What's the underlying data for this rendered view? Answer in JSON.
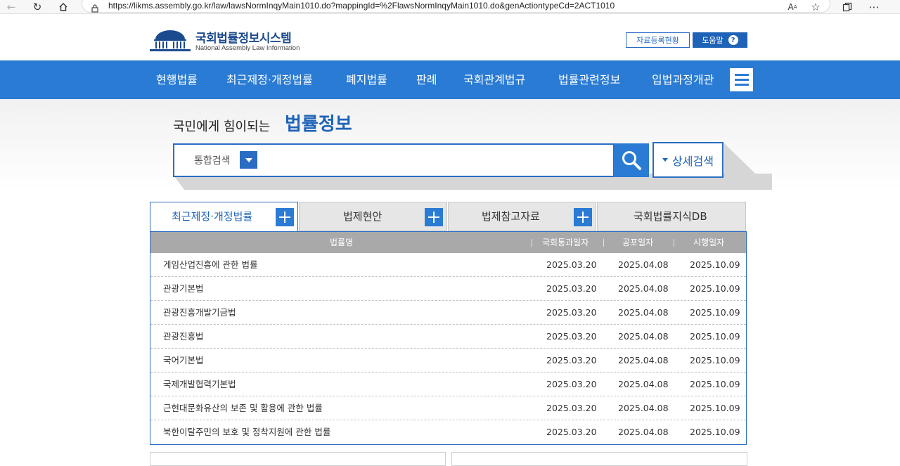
{
  "browser": {
    "url": "https://likms.assembly.go.kr/law/lawsNormInqyMain1010.do?mappingId=%2FlawsNormInqyMain1010.do&genActiontypeCd=2ACT1010",
    "icons": [
      "back-icon",
      "refresh-icon",
      "home-icon",
      "lock-icon",
      "read-aloud-icon",
      "favorite-star-icon",
      "collections-icon",
      "more-icon"
    ]
  },
  "header": {
    "title": "국회법률정보시스템",
    "subtitle": "National Assembly Law Information",
    "reg_status": "자료등록현황",
    "help": "도움말",
    "help_icon": "?"
  },
  "nav": {
    "items": [
      "현행법률",
      "최근제정·개정법률",
      "폐지법률",
      "판례",
      "국회관계법규",
      "법률관련정보",
      "입법과정개관"
    ]
  },
  "search": {
    "tagline_prefix": "국민에게 힘이되는",
    "tagline_emphasis": "법률정보",
    "type": "통합검색",
    "query": "",
    "advanced": "상세검색"
  },
  "tabs": [
    "최근제정·개정법률",
    "법제현안",
    "법제참고자료",
    "국회법률지식DB"
  ],
  "table": {
    "headers": [
      "법률명",
      "국회통과일자",
      "공포일자",
      "시행일자"
    ],
    "rows": [
      {
        "name": "게임산업진흥에 관한 법률",
        "passed": "2025.03.20",
        "promulgated": "2025.04.08",
        "effective": "2025.10.09"
      },
      {
        "name": "관광기본법",
        "passed": "2025.03.20",
        "promulgated": "2025.04.08",
        "effective": "2025.10.09"
      },
      {
        "name": "관광진흥개발기금법",
        "passed": "2025.03.20",
        "promulgated": "2025.04.08",
        "effective": "2025.10.09"
      },
      {
        "name": "관광진흥법",
        "passed": "2025.03.20",
        "promulgated": "2025.04.08",
        "effective": "2025.10.09"
      },
      {
        "name": "국어기본법",
        "passed": "2025.03.20",
        "promulgated": "2025.04.08",
        "effective": "2025.10.09"
      },
      {
        "name": "국제개발협력기본법",
        "passed": "2025.03.20",
        "promulgated": "2025.04.08",
        "effective": "2025.10.09"
      },
      {
        "name": "근현대문화유산의 보존 및 활용에 관한 법률",
        "passed": "2025.03.20",
        "promulgated": "2025.04.08",
        "effective": "2025.10.09"
      },
      {
        "name": "북한이탈주민의 보호 및 정착지원에 관한 법률",
        "passed": "2025.03.20",
        "promulgated": "2025.04.08",
        "effective": "2025.10.09"
      }
    ]
  },
  "colors": {
    "nav_blue": "#2a7bd4",
    "brand_blue": "#1f63b8",
    "table_header": "#a9a9a9"
  }
}
